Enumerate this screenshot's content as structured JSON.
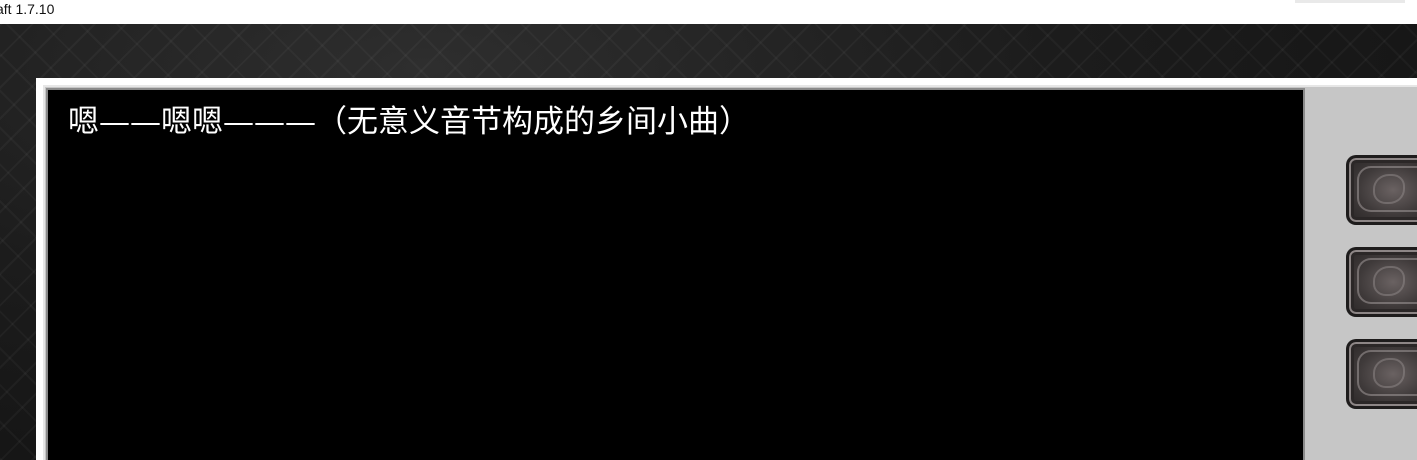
{
  "window": {
    "title": "aft 1.7.10"
  },
  "dialog": {
    "text": "嗯——嗯嗯———（无意义音节构成的乡间小曲）"
  },
  "side_buttons": [
    {
      "icon": "ornament-icon"
    },
    {
      "icon": "ornament-icon"
    },
    {
      "icon": "ornament-icon"
    }
  ],
  "colors": {
    "text_screen_bg": "#000000",
    "panel_bg": "#c6c6c6",
    "text_color": "#ffffff"
  }
}
